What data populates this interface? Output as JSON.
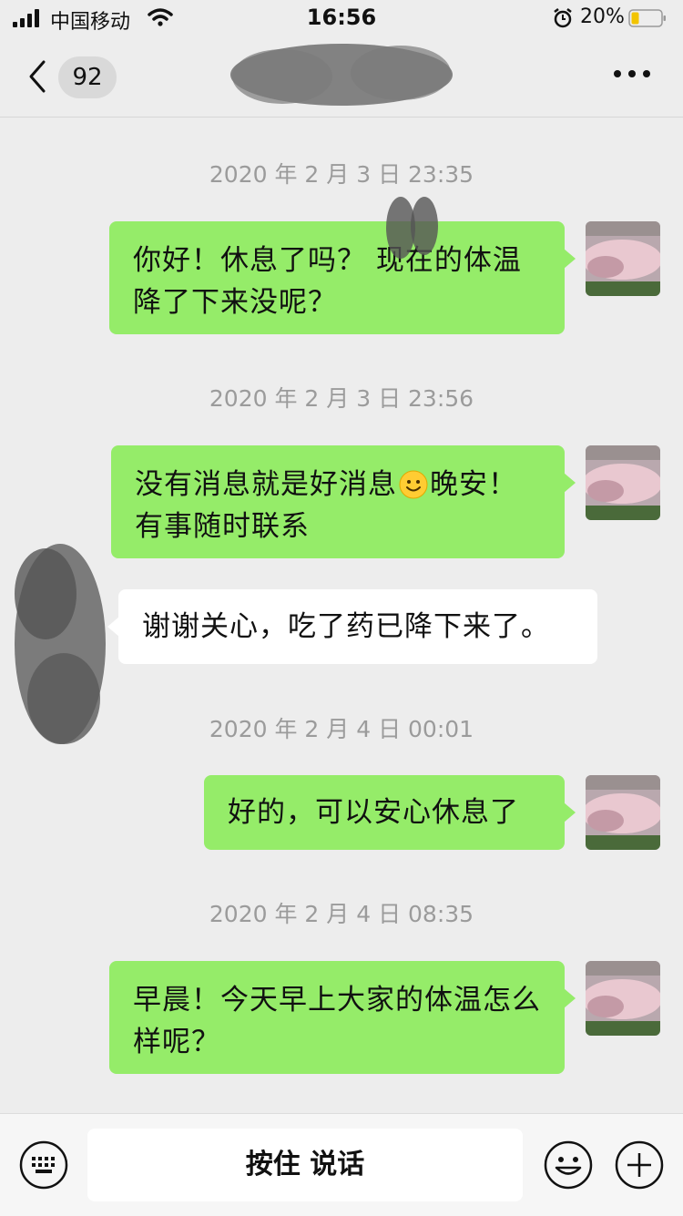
{
  "status_bar": {
    "carrier": "中国移动",
    "time": "16:56",
    "battery_percent": "20%",
    "battery_color": "#f2c400"
  },
  "header": {
    "back_icon": "chevron-left-icon",
    "unread_count": "92",
    "more_icon": "more-dots-icon"
  },
  "messages": [
    {
      "type": "timestamp",
      "text": "2020 年 2 月 3 日 23:35"
    },
    {
      "type": "outgoing",
      "text": "你好！休息了吗？  现在的体温降了下来没呢？"
    },
    {
      "type": "timestamp",
      "text": "2020 年 2 月 3 日 23:56"
    },
    {
      "type": "outgoing",
      "text_before": "没有消息就是好消息",
      "emoji": "smile-emoji",
      "text_after": "晚安！有事随时联系"
    },
    {
      "type": "incoming",
      "text": "谢谢关心，吃了药已降下来了。"
    },
    {
      "type": "timestamp",
      "text": "2020 年 2 月 4 日 00:01"
    },
    {
      "type": "outgoing",
      "text": "好的，可以安心休息了"
    },
    {
      "type": "timestamp",
      "text": "2020 年 2 月 4 日 08:35"
    },
    {
      "type": "outgoing",
      "text": "早晨！今天早上大家的体温怎么样呢？"
    }
  ],
  "input_bar": {
    "keyboard_icon": "keyboard-icon",
    "voice_label": "按住 说话",
    "emoji_icon": "emoji-icon",
    "plus_icon": "plus-icon"
  },
  "colors": {
    "background": "#ededed",
    "outgoing_bubble": "#95ec69",
    "incoming_bubble": "#ffffff",
    "timestamp": "#9b9b9b"
  }
}
